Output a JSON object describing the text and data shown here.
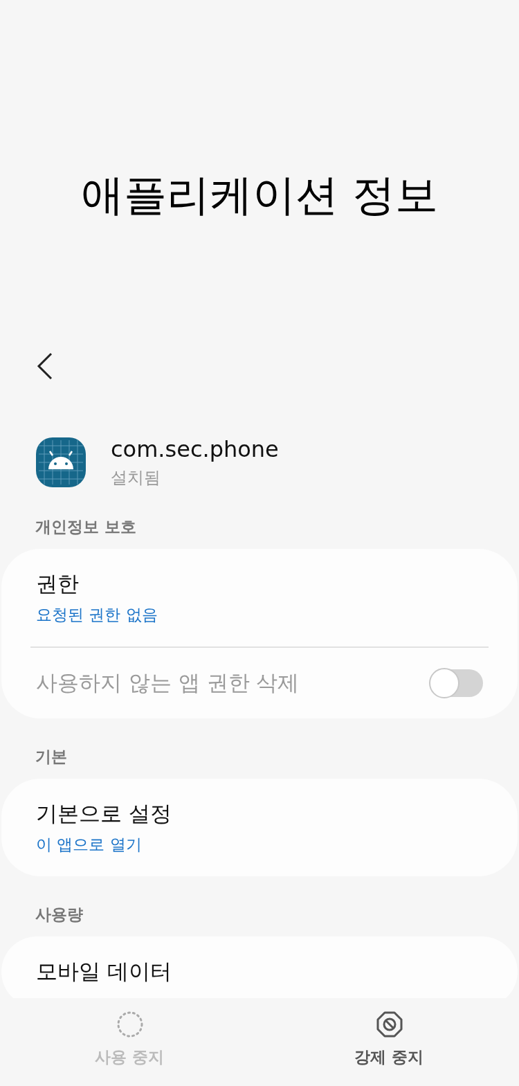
{
  "header": {
    "title": "애플리케이션 정보"
  },
  "app": {
    "name": "com.sec.phone",
    "status": "설치됨"
  },
  "sections": [
    {
      "title": "개인정보 보호",
      "rows": [
        {
          "kind": "link",
          "title": "권한",
          "subtitle": "요청된 권한 없음"
        },
        {
          "kind": "switch",
          "title": "사용하지 않는 앱 권한 삭제",
          "disabled": true,
          "on": false
        }
      ]
    },
    {
      "title": "기본",
      "rows": [
        {
          "kind": "link",
          "title": "기본으로 설정",
          "subtitle": "이 앱으로 열기"
        }
      ]
    },
    {
      "title": "사용량",
      "rows": [
        {
          "kind": "link",
          "title": "모바일 데이터"
        }
      ]
    }
  ],
  "actions": [
    {
      "kind": "disable",
      "label": "사용 중지",
      "disabled": true
    },
    {
      "kind": "force_stop",
      "label": "강제 중지",
      "disabled": false
    }
  ]
}
